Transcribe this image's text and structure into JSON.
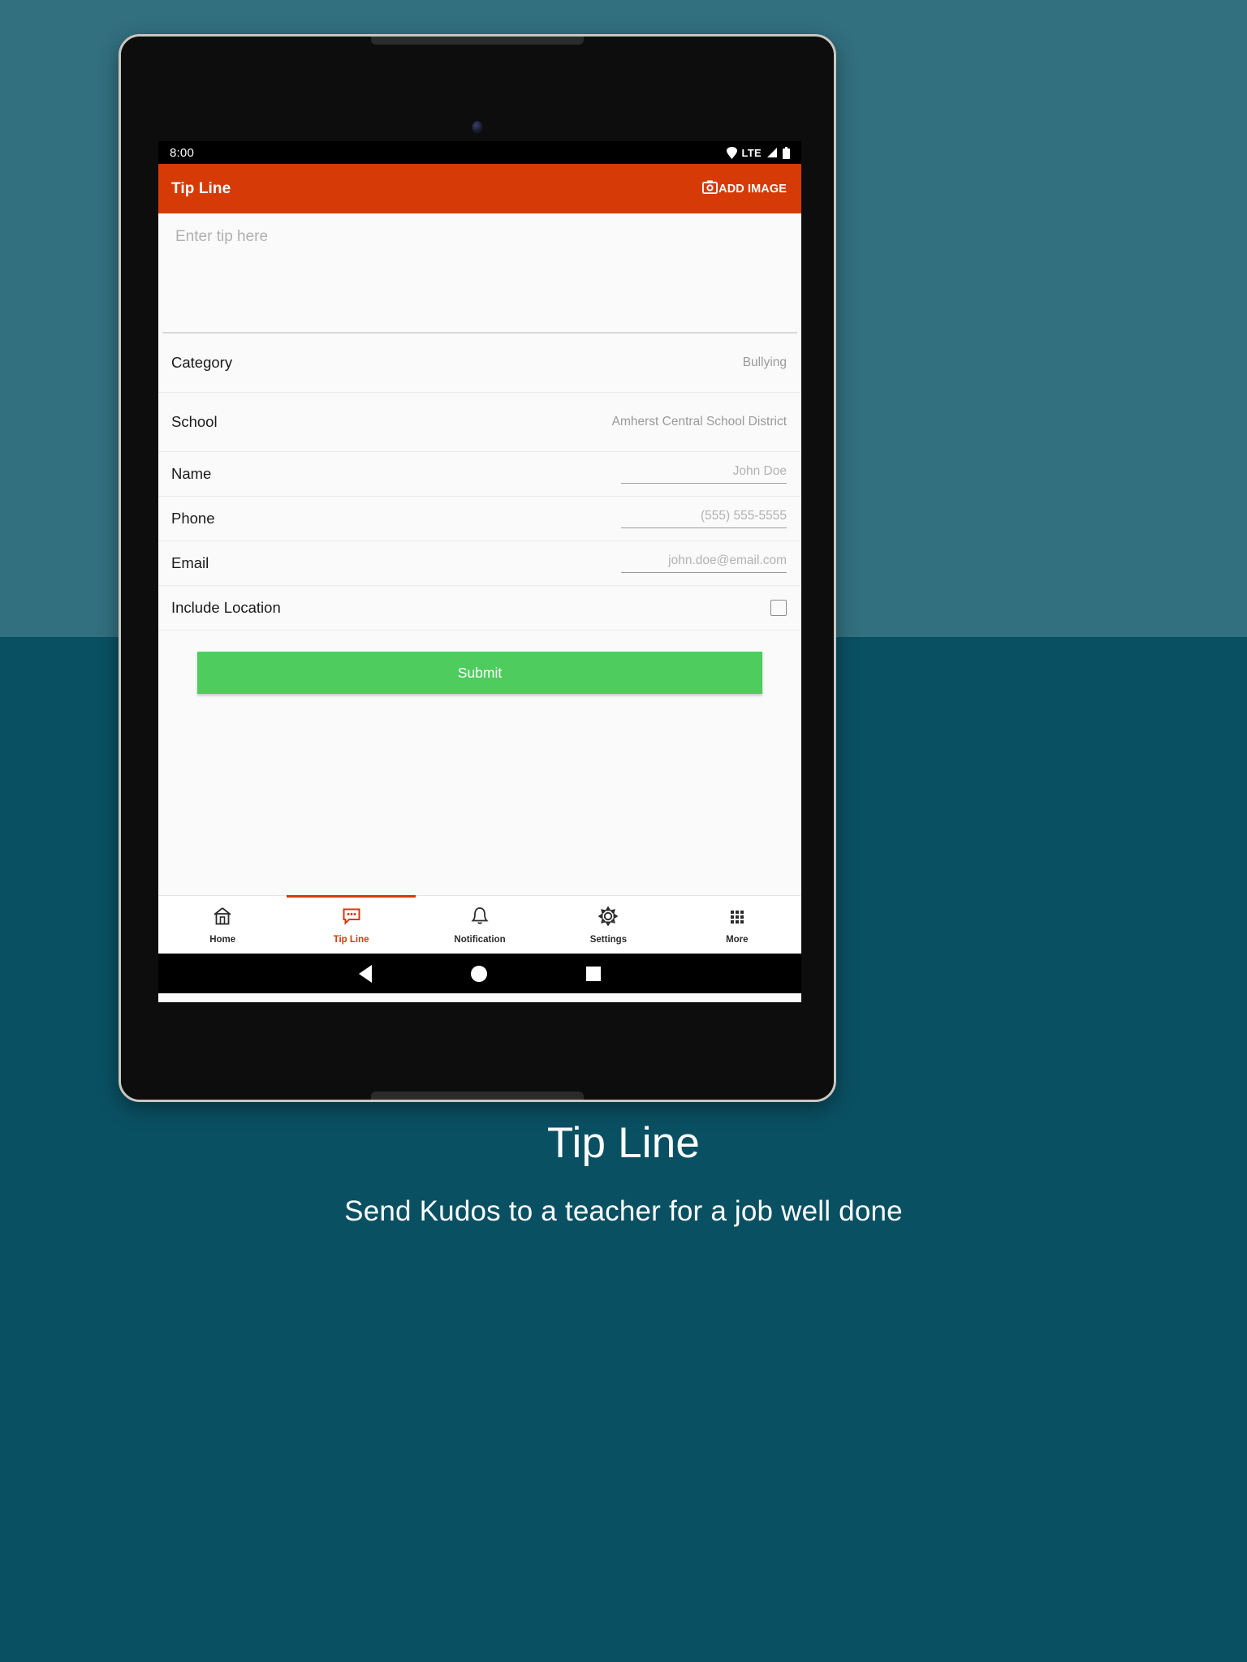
{
  "theme": {
    "background_top": "#32707f",
    "background_bottom": "#0a5063",
    "accent": "#d63a06",
    "submit_green": "#4ecc5e",
    "screen_bg": "#fafafa"
  },
  "status_bar": {
    "time": "8:00",
    "network_label": "LTE",
    "icons": [
      "wifi-icon",
      "signal-icon",
      "battery-icon"
    ]
  },
  "app_bar": {
    "title": "Tip Line",
    "action_label": "ADD IMAGE",
    "action_icon": "camera-icon"
  },
  "form": {
    "tip_placeholder": "Enter tip here",
    "rows": [
      {
        "label": "Category",
        "value": "Bullying",
        "kind": "select"
      },
      {
        "label": "School",
        "value": "Amherst Central School District",
        "kind": "select"
      },
      {
        "label": "Name",
        "value": "John Doe",
        "kind": "input"
      },
      {
        "label": "Phone",
        "value": "(555) 555-5555",
        "kind": "input"
      },
      {
        "label": "Email",
        "value": "john.doe@email.com",
        "kind": "input"
      },
      {
        "label": "Include Location",
        "value": "",
        "kind": "checkbox",
        "checked": false
      }
    ],
    "submit_label": "Submit"
  },
  "bottom_nav": {
    "active_index": 1,
    "items": [
      {
        "label": "Home",
        "icon": "home-icon"
      },
      {
        "label": "Tip Line",
        "icon": "chat-bubble-icon"
      },
      {
        "label": "Notification",
        "icon": "bell-icon"
      },
      {
        "label": "Settings",
        "icon": "gear-icon"
      },
      {
        "label": "More",
        "icon": "grid-dots-icon"
      }
    ]
  },
  "android_nav": {
    "back": "back-triangle-icon",
    "home": "home-circle-icon",
    "recents": "recents-square-icon"
  },
  "caption": {
    "title": "Tip Line",
    "subtitle": "Send Kudos to a teacher for a job well done"
  }
}
